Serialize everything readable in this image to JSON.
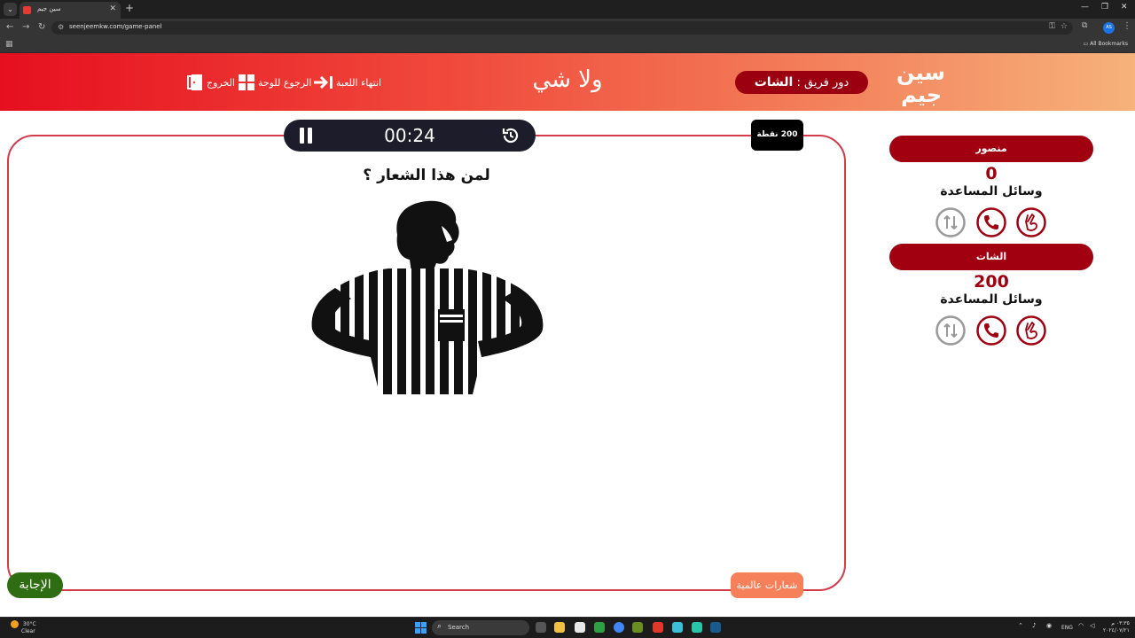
{
  "browser": {
    "tab_title": "سين جيم",
    "url": "seenjeemkw.com/game-panel",
    "profile_initials": "AS",
    "all_bookmarks": "All Bookmarks"
  },
  "header": {
    "logo_line1": "سين",
    "logo_line2": "جيم",
    "team_turn_prefix": "دور فريق :",
    "team_turn_name": "الشات",
    "center_title": "ولا شي",
    "end_game": "انتهاء اللعبة",
    "back_to_board": "الرجوع للوحة",
    "exit": "الخروج"
  },
  "game": {
    "timer": "00:24",
    "points": "200 نقطة",
    "question": "لمن هذا الشعار ؟",
    "category": "شعارات عالمية",
    "answer_button": "الإجابة"
  },
  "teams": [
    {
      "name": "منصور",
      "score": "0",
      "aids_label": "وسائل المساعدة"
    },
    {
      "name": "الشات",
      "score": "200",
      "aids_label": "وسائل المساعدة"
    }
  ],
  "taskbar": {
    "temperature": "30°C",
    "weather": "Clear",
    "search_placeholder": "Search",
    "lang": "ENG",
    "time": "٠٣:٣٥ م",
    "date": "٢٠٢٤/٠٧/٢١"
  },
  "colors": {
    "brand_red": "#a10010",
    "header_gradient_start": "#e60f1f",
    "header_gradient_end": "#f6b27b",
    "answer_green": "#2e6d12",
    "category_orange": "#f6805a"
  }
}
